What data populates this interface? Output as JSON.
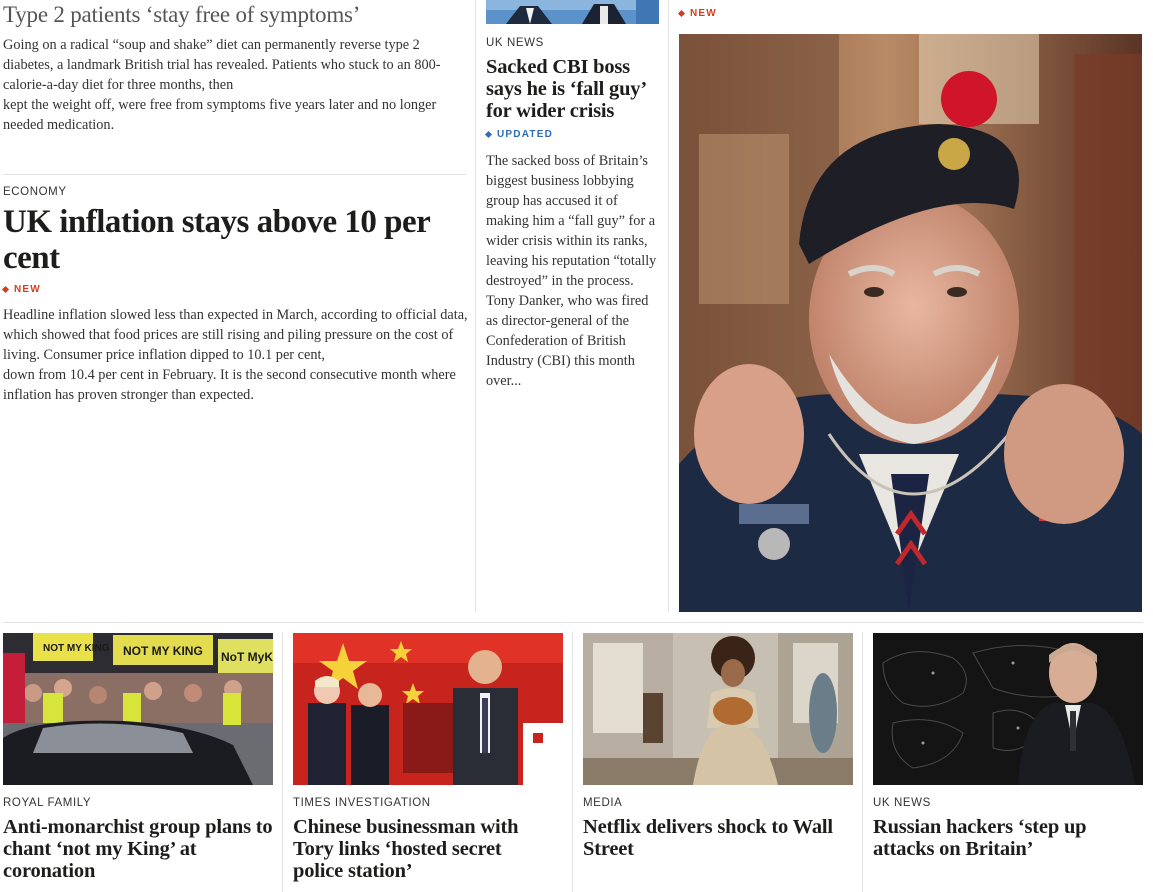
{
  "top_left_story": {
    "headline": "Type 2 patients ‘stay free of symptoms’",
    "summary_line1": "Going on a radical “soup and shake” diet can permanently reverse type 2 diabetes, a landmark British trial has revealed. Patients who stuck to an 800-calorie-a-day diet for three months, then",
    "summary_line2": "kept the weight off, were free from symptoms five years later and no longer needed medication."
  },
  "lead_story": {
    "section": "ECONOMY",
    "headline": "UK inflation stays above 10 per cent",
    "flag": "NEW",
    "summary_line1": "Headline inflation slowed less than expected in March, according to official data, which showed that food prices are still rising and piling pressure on the cost of living. Consumer price inflation dipped to 10.1 per cent,",
    "summary_line2": "down from 10.4 per cent in February. It is the second consecutive month where inflation has proven stronger than expected."
  },
  "middle_story": {
    "section": "UK NEWS",
    "headline": "Sacked CBI boss says he is ‘fall guy’ for wider crisis",
    "flag": "UPDATED",
    "summary": "The sacked boss of Britain’s biggest business lobbying group has accused it of making him a “fall guy” for a wider crisis within its ranks, leaving his reputation “totally destroyed” in the process. Tony Danker, who was fired as director-general of the Confederation of British Industry (CBI) this month over..."
  },
  "right_story": {
    "flag": "NEW"
  },
  "bottom_cards": [
    {
      "section": "ROYAL FAMILY",
      "headline": "Anti-monarchist group plans to chant ‘not my King’ at coronation",
      "sign1": "NOT MY KING",
      "sign2": "NOT MY KING",
      "sign3": "NoT MyKing"
    },
    {
      "section": "TIMES INVESTIGATION",
      "headline": "Chinese businessman with Tory links ‘hosted secret police station’"
    },
    {
      "section": "MEDIA",
      "headline": "Netflix delivers shock to Wall Street"
    },
    {
      "section": "UK NEWS",
      "headline": "Russian hackers ‘step up attacks on Britain’"
    }
  ],
  "colors": {
    "new_flag": "#d63c1c",
    "updated_flag": "#2f6db5",
    "rule": "#e3e3e3"
  }
}
